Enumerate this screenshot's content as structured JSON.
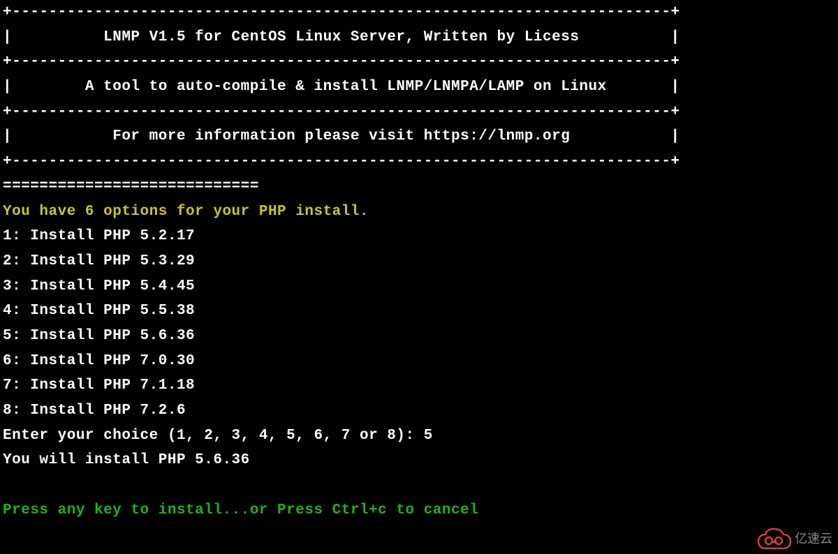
{
  "header": {
    "border": "+------------------------------------------------------------------------+",
    "title_line": "|          LNMP V1.5 for CentOS Linux Server, Written by Licess          |",
    "subtitle_line": "|        A tool to auto-compile & install LNMP/LNMPA/LAMP on Linux       |",
    "info_line": "|           For more information please visit https://lnmp.org           |"
  },
  "separator": "============================",
  "prompt": {
    "heading": "You have 6 options for your PHP install.",
    "options": [
      "1: Install PHP 5.2.17",
      "2: Install PHP 5.3.29",
      "3: Install PHP 5.4.45",
      "4: Install PHP 5.5.38",
      "5: Install PHP 5.6.36",
      "6: Install PHP 7.0.30",
      "7: Install PHP 7.1.18",
      "8: Install PHP 7.2.6"
    ],
    "choice_prompt": "Enter your choice (1, 2, 3, 4, 5, 6, 7 or 8): ",
    "choice_value": "5",
    "confirmation": "You will install PHP 5.6.36",
    "continue_prompt": "Press any key to install...or Press Ctrl+c to cancel"
  },
  "watermark": {
    "text": "亿速云"
  }
}
